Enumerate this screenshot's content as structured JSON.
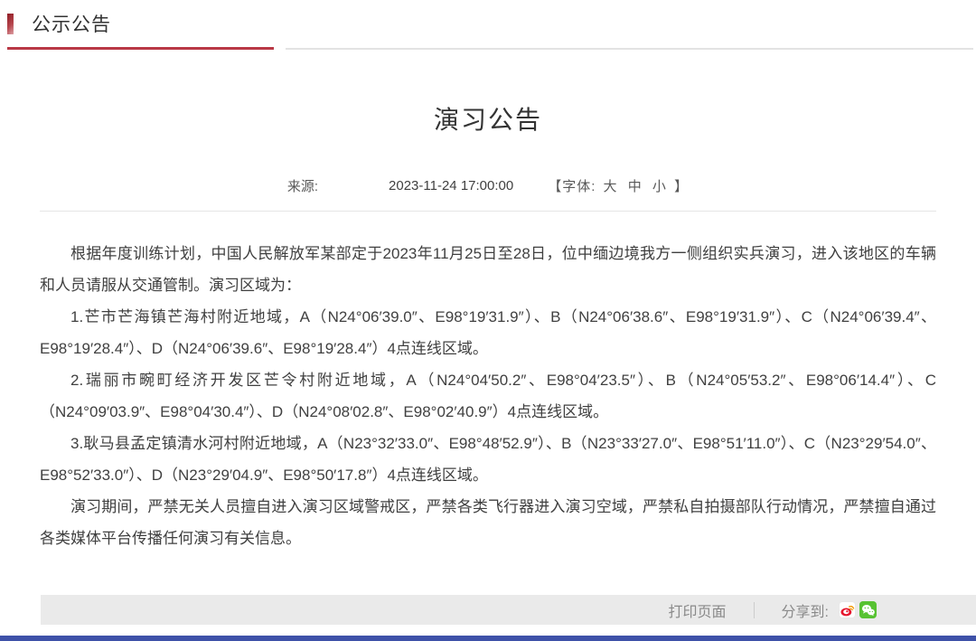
{
  "section_header": {
    "title": "公示公告"
  },
  "article": {
    "title": "演习公告",
    "meta": {
      "source_label": "来源:",
      "datetime": "2023-11-24 17:00:00",
      "font_prefix": "【字体:",
      "font_sizes": [
        "大",
        "中",
        "小"
      ],
      "font_suffix": "】"
    },
    "paragraphs": [
      "根据年度训练计划，中国人民解放军某部定于2023年11月25日至28日，位中缅边境我方一侧组织实兵演习，进入该地区的车辆和人员请服从交通管制。演习区域为：",
      "1.芒市芒海镇芒海村附近地域，A（N24°06′39.0″、E98°19′31.9″）、B（N24°06′38.6″、E98°19′31.9″）、C（N24°06′39.4″、E98°19′28.4″）、D（N24°06′39.6″、E98°19′28.4″）4点连线区域。",
      "2.瑞丽市畹町经济开发区芒令村附近地域，A（N24°04′50.2″、E98°04′23.5″）、B（N24°05′53.2″、E98°06′14.4″）、C（N24°09′03.9″、E98°04′30.4″）、D（N24°08′02.8″、E98°02′40.9″）4点连线区域。",
      "3.耿马县孟定镇清水河村附近地域，A（N23°32′33.0″、E98°48′52.9″）、B（N23°33′27.0″、E98°51′11.0″）、C（N23°29′54.0″、E98°52′33.0″）、D（N23°29′04.9″、E98°50′17.8″）4点连线区域。",
      "演习期间，严禁无关人员擅自进入演习区域警戒区，严禁各类飞行器进入演习空域，严禁私自拍摄部队行动情况，严禁擅自通过各类媒体平台传播任何演习有关信息。"
    ]
  },
  "footer": {
    "print_label": "打印页面",
    "share_label": "分享到:",
    "icons": [
      "weibo-icon",
      "wechat-icon"
    ]
  },
  "colors": {
    "accent_red": "#b93946",
    "footer_bar_bg": "#eaeaea",
    "bottom_bar_blue": "#3e51a8",
    "weibo_red": "#e6162d",
    "wechat_green": "#57c232"
  }
}
